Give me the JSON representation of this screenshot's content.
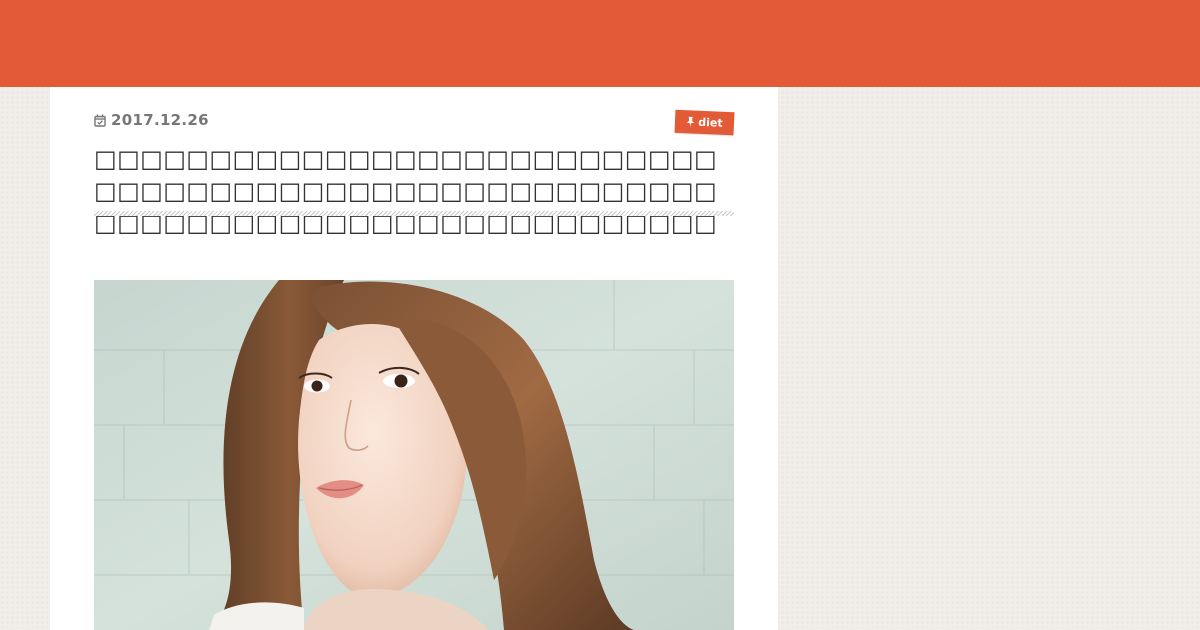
{
  "post": {
    "date": "2017.12.26",
    "category": "diet",
    "title": "□□□□□□□□□□□□□□□□□□□□□□□□□□□□□□□□□□□□□□□□□□□□□□□□□□□□□□□□□□□□□□□□□□□□□□□□□□□□□□□□□"
  },
  "icons": {
    "date": "calendar-check-icon",
    "category": "pin-icon"
  },
  "colors": {
    "accent": "#e35a37",
    "page_background": "#f1eee9",
    "content_background": "#ffffff",
    "meta_text": "#777777",
    "title_text": "#333333"
  }
}
